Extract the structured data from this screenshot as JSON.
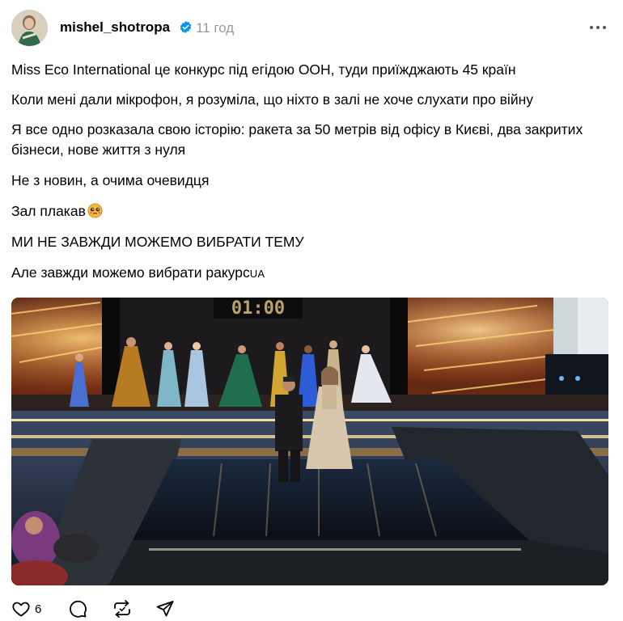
{
  "post": {
    "username": "mishel_shotropa",
    "timestamp": "11 год",
    "verified_icon": "verified-badge-icon",
    "more_icon": "more-options-icon",
    "lines": [
      "Miss Eco International це конкурс під егідою ООН, туди приїжджають 45 країн",
      "Коли мені дали мікрофон, я розуміла, що ніхто в залі не хоче слухати про війну",
      "Я все одно розказала свою історію: ракета за 50 метрів від офісу в Києві, два закритих бізнеси, нове життя з нуля",
      "Не з новин, а очима очевидця",
      "Зал плакав",
      "МИ НЕ ЗАВЖДИ МОЖЕМО ВИБРАТИ ТЕМУ",
      "Але завжди можемо вибрати ракурс"
    ],
    "crying_emoji": "pleading-face-emoji",
    "hashtag": "UA",
    "media": {
      "countdown": "01:00"
    },
    "actions": {
      "like_count": "6",
      "like_icon": "heart-icon",
      "comment_icon": "comment-icon",
      "repost_icon": "repost-icon",
      "share_icon": "share-icon"
    }
  },
  "colors": {
    "verified": "#0095f6",
    "timestamp": "#999999",
    "text": "#000000"
  }
}
